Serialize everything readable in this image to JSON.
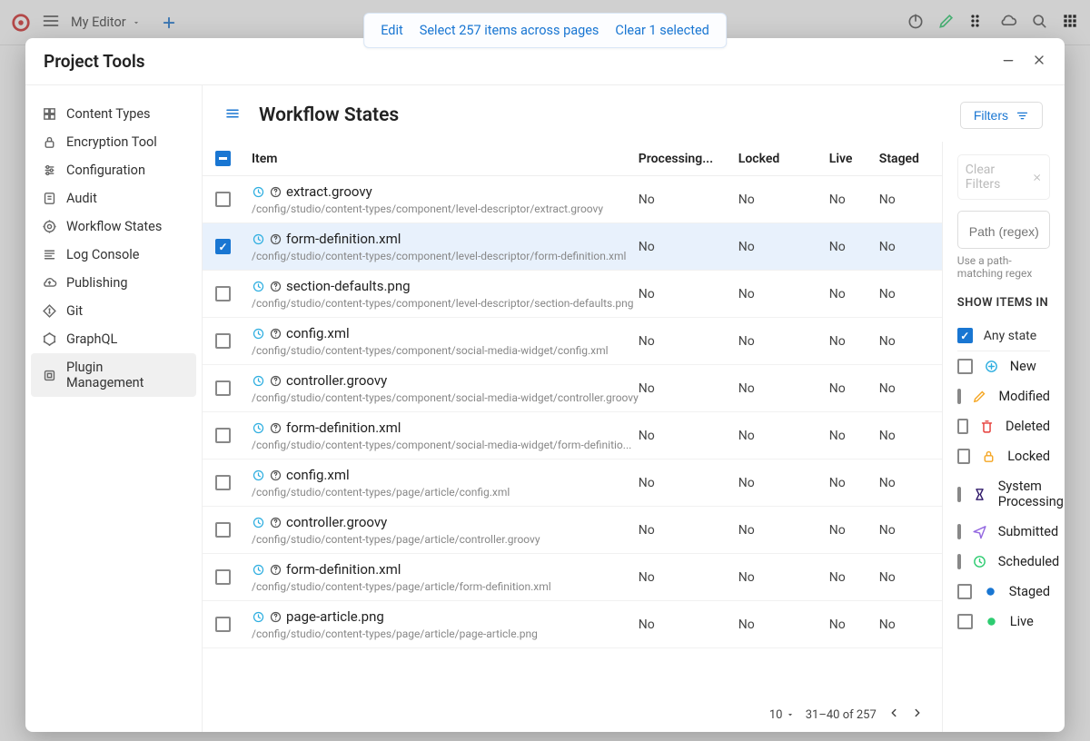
{
  "toolbar": {
    "site_label": "My Editor"
  },
  "floating_bar": {
    "edit": "Edit",
    "select_all": "Select 257 items across pages",
    "clear_sel": "Clear 1 selected"
  },
  "modal": {
    "title": "Project Tools",
    "main_title": "Workflow States",
    "filters_btn": "Filters",
    "clear_filters": "Clear Filters",
    "path_placeholder": "Path (regex)",
    "path_hint": "Use a path-matching regex",
    "show_items_in": "SHOW ITEMS IN"
  },
  "sidebar": {
    "items": [
      {
        "label": "Content Types"
      },
      {
        "label": "Encryption Tool"
      },
      {
        "label": "Configuration"
      },
      {
        "label": "Audit"
      },
      {
        "label": "Workflow States"
      },
      {
        "label": "Log Console"
      },
      {
        "label": "Publishing"
      },
      {
        "label": "Git"
      },
      {
        "label": "GraphQL"
      },
      {
        "label": "Plugin Management"
      }
    ]
  },
  "table": {
    "headers": {
      "item": "Item",
      "processing": "Processing...",
      "locked": "Locked",
      "live": "Live",
      "staged": "Staged"
    },
    "rows": [
      {
        "name": "extract.groovy",
        "path": "/config/studio/content-types/component/level-descriptor/extract.groovy",
        "proc": "No",
        "locked": "No",
        "live": "No",
        "staged": "No",
        "selected": false
      },
      {
        "name": "form-definition.xml",
        "path": "/config/studio/content-types/component/level-descriptor/form-definition.xml",
        "proc": "No",
        "locked": "No",
        "live": "No",
        "staged": "No",
        "selected": true
      },
      {
        "name": "section-defaults.png",
        "path": "/config/studio/content-types/component/level-descriptor/section-defaults.png",
        "proc": "No",
        "locked": "No",
        "live": "No",
        "staged": "No",
        "selected": false
      },
      {
        "name": "config.xml",
        "path": "/config/studio/content-types/component/social-media-widget/config.xml",
        "proc": "No",
        "locked": "No",
        "live": "No",
        "staged": "No",
        "selected": false
      },
      {
        "name": "controller.groovy",
        "path": "/config/studio/content-types/component/social-media-widget/controller.groovy",
        "proc": "No",
        "locked": "No",
        "live": "No",
        "staged": "No",
        "selected": false
      },
      {
        "name": "form-definition.xml",
        "path": "/config/studio/content-types/component/social-media-widget/form-definitio...",
        "proc": "No",
        "locked": "No",
        "live": "No",
        "staged": "No",
        "selected": false
      },
      {
        "name": "config.xml",
        "path": "/config/studio/content-types/page/article/config.xml",
        "proc": "No",
        "locked": "No",
        "live": "No",
        "staged": "No",
        "selected": false
      },
      {
        "name": "controller.groovy",
        "path": "/config/studio/content-types/page/article/controller.groovy",
        "proc": "No",
        "locked": "No",
        "live": "No",
        "staged": "No",
        "selected": false
      },
      {
        "name": "form-definition.xml",
        "path": "/config/studio/content-types/page/article/form-definition.xml",
        "proc": "No",
        "locked": "No",
        "live": "No",
        "staged": "No",
        "selected": false
      },
      {
        "name": "page-article.png",
        "path": "/config/studio/content-types/page/article/page-article.png",
        "proc": "No",
        "locked": "No",
        "live": "No",
        "staged": "No",
        "selected": false
      }
    ]
  },
  "pager": {
    "page_size": "10",
    "range": "31–40 of 257"
  },
  "filters": {
    "any_state": "Any state",
    "states": [
      {
        "label": "New",
        "color": "#2eaee0"
      },
      {
        "label": "Modified",
        "color": "#f5a623"
      },
      {
        "label": "Deleted",
        "color": "#e53935"
      },
      {
        "label": "Locked",
        "color": "#f5a623"
      },
      {
        "label": "System Processing",
        "color": "#311b6b"
      },
      {
        "label": "Submitted",
        "color": "#9367e0"
      },
      {
        "label": "Scheduled",
        "color": "#2ecc71"
      },
      {
        "label": "Staged",
        "color": "#1976d2"
      },
      {
        "label": "Live",
        "color": "#2ecc71"
      }
    ]
  }
}
